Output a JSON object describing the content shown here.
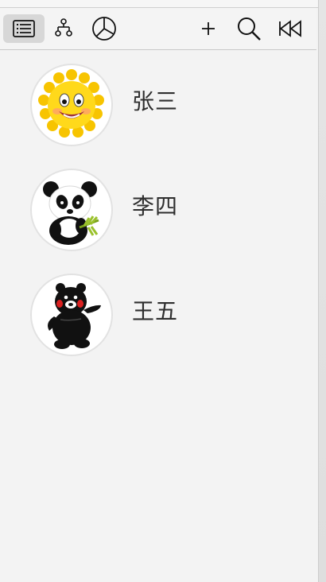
{
  "toolbar": {
    "buttons": [
      {
        "icon": "list-icon"
      },
      {
        "icon": "org-chart-icon"
      },
      {
        "icon": "pie-chart-icon"
      },
      {
        "icon": "add-icon"
      },
      {
        "icon": "search-icon"
      },
      {
        "icon": "rewind-icon"
      }
    ]
  },
  "contacts": [
    {
      "name": "张三",
      "avatar": "sun-avatar-icon"
    },
    {
      "name": "李四",
      "avatar": "panda-avatar-icon"
    },
    {
      "name": "王五",
      "avatar": "bear-avatar-icon"
    }
  ],
  "colors": {
    "background": "#f3f3f3",
    "toolbar_active": "#d7d7d7",
    "text": "#2e2e2e",
    "divider": "#c9c9c9"
  }
}
